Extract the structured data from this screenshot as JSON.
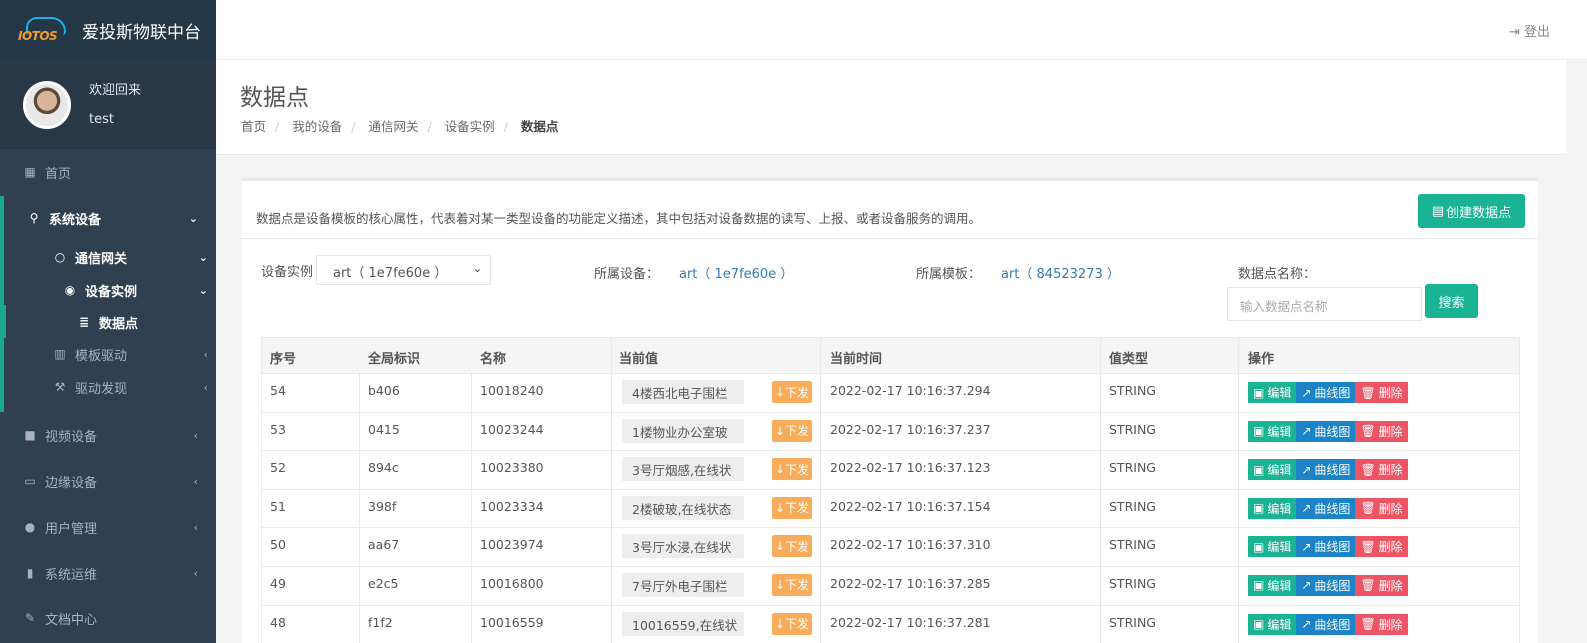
{
  "app": {
    "logo_text": "IOTOS",
    "brand_name": "爱投斯物联中台"
  },
  "profile": {
    "welcome": "欢迎回来",
    "username": "test"
  },
  "sidebar": {
    "items": [
      {
        "label": "首页",
        "icon": "dashboard-icon"
      },
      {
        "label": "系统设备",
        "icon": "sitemap-icon"
      },
      {
        "label": "通信网关",
        "icon": "circle-icon"
      },
      {
        "label": "设备实例",
        "icon": "rebel-icon"
      },
      {
        "label": "数据点",
        "icon": "database-icon"
      },
      {
        "label": "模板驱动",
        "icon": "book-icon"
      },
      {
        "label": "驱动发现",
        "icon": "gavel-icon"
      },
      {
        "label": "视频设备",
        "icon": "video-icon"
      },
      {
        "label": "边缘设备",
        "icon": "laptop-icon"
      },
      {
        "label": "用户管理",
        "icon": "user-icon"
      },
      {
        "label": "系统运维",
        "icon": "bar-chart-icon"
      },
      {
        "label": "文档中心",
        "icon": "edit-icon"
      }
    ]
  },
  "topbar": {
    "logout_label": "登出"
  },
  "page": {
    "title": "数据点",
    "breadcrumb": [
      "首页",
      "我的设备",
      "通信网关",
      "设备实例",
      "数据点"
    ]
  },
  "content": {
    "description": "数据点是设备模板的核心属性，代表着对某一类型设备的功能定义描述，其中包括对设备数据的读写、上报、或者设备服务的调用。",
    "create_button": "创建数据点",
    "filters": {
      "instance_label": "设备实例",
      "instance_value": "art（ 1e7fe60e ）",
      "device_label": "所属设备：",
      "device_value": "art（ 1e7fe60e ）",
      "template_label": "所属模板：",
      "template_value": "art（ 84523273 ）",
      "name_label": "数据点名称：",
      "name_placeholder": "输入数据点名称",
      "search_button": "搜索"
    },
    "table": {
      "headers": [
        "序号",
        "全局标识",
        "名称",
        "当前值",
        "当前时间",
        "值类型",
        "操作"
      ],
      "send_label": "下发",
      "edit_label": "编辑",
      "curve_label": "曲线图",
      "delete_label": "删除",
      "rows": [
        {
          "no": "54",
          "gid": "b406",
          "name": "10018240",
          "value": "4楼西北电子围栏",
          "time": "2022-02-17 10:16:37.294",
          "type": "STRING"
        },
        {
          "no": "53",
          "gid": "0415",
          "name": "10023244",
          "value": "1楼物业办公室玻",
          "time": "2022-02-17 10:16:37.237",
          "type": "STRING"
        },
        {
          "no": "52",
          "gid": "894c",
          "name": "10023380",
          "value": "3号厅烟感,在线状",
          "time": "2022-02-17 10:16:37.123",
          "type": "STRING"
        },
        {
          "no": "51",
          "gid": "398f",
          "name": "10023334",
          "value": "2楼破玻,在线状态",
          "time": "2022-02-17 10:16:37.154",
          "type": "STRING"
        },
        {
          "no": "50",
          "gid": "aa67",
          "name": "10023974",
          "value": "3号厅水浸,在线状",
          "time": "2022-02-17 10:16:37.310",
          "type": "STRING"
        },
        {
          "no": "49",
          "gid": "e2c5",
          "name": "10016800",
          "value": "7号厅外电子围栏",
          "time": "2022-02-17 10:16:37.285",
          "type": "STRING"
        },
        {
          "no": "48",
          "gid": "f1f2",
          "name": "10016559",
          "value": "10016559,在线状",
          "time": "2022-02-17 10:16:37.281",
          "type": "STRING"
        }
      ]
    }
  }
}
